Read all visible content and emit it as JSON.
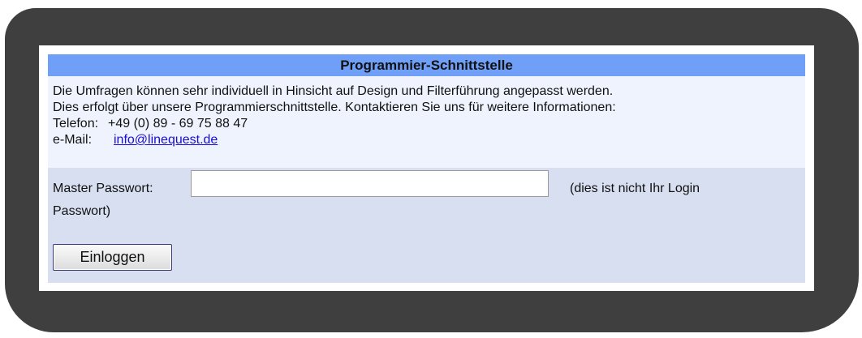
{
  "section": {
    "title": "Programmier-Schnittstelle"
  },
  "info": {
    "line1": "Die Umfragen können sehr individuell in Hinsicht auf Design und Filterführung angepasst werden.",
    "line2": "Dies erfolgt über unsere Programmierschnittstelle. Kontaktieren Sie uns für weitere Informationen:",
    "phone_label": "Telefon:",
    "phone_value": "+49 (0) 89 - 69 75 88 47",
    "email_label": "e-Mail:",
    "email_value": "info@linequest.de"
  },
  "login": {
    "password_label": "Master Passwort:",
    "password_value": "",
    "note_part1": "(dies ist nicht Ihr Login",
    "note_part2": "Passwort)",
    "button_label": "Einloggen"
  },
  "colors": {
    "frame": "#3f3f3f",
    "header_bg": "#6f9ff6",
    "info_bg": "#eef3fd",
    "login_bg": "#d7dff0",
    "link": "#1a0dd6"
  }
}
